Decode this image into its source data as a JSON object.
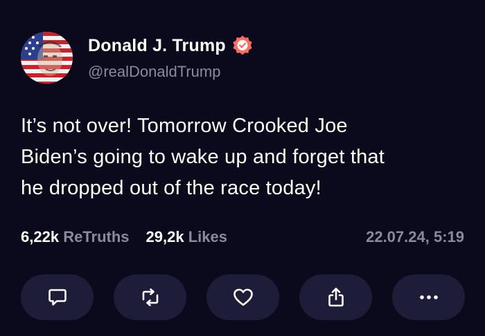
{
  "user": {
    "display_name": "Donald J. Trump",
    "handle": "@realDonaldTrump",
    "avatar_icon": "avatar-flag-portrait",
    "verified_icon": "verified-badge-icon",
    "verified_color": "#ff6b5f"
  },
  "post": {
    "line1": "It’s not over! Tomorrow Crooked Joe",
    "line2": "Biden’s going to wake up and forget that",
    "line3": "he dropped out of the race today!"
  },
  "stats": {
    "retruths_count": "6,22k",
    "retruths_label": "ReTruths",
    "likes_count": "29,2k",
    "likes_label": "Likes",
    "timestamp": "22.07.24, 5:19"
  },
  "actions": [
    {
      "icon": "reply-icon"
    },
    {
      "icon": "retruth-icon"
    },
    {
      "icon": "heart-icon"
    },
    {
      "icon": "share-icon"
    },
    {
      "icon": "more-icon"
    }
  ],
  "colors": {
    "background": "#0b0a1c",
    "button_background": "#1d1d3a",
    "secondary_text": "#8a8a9a"
  }
}
